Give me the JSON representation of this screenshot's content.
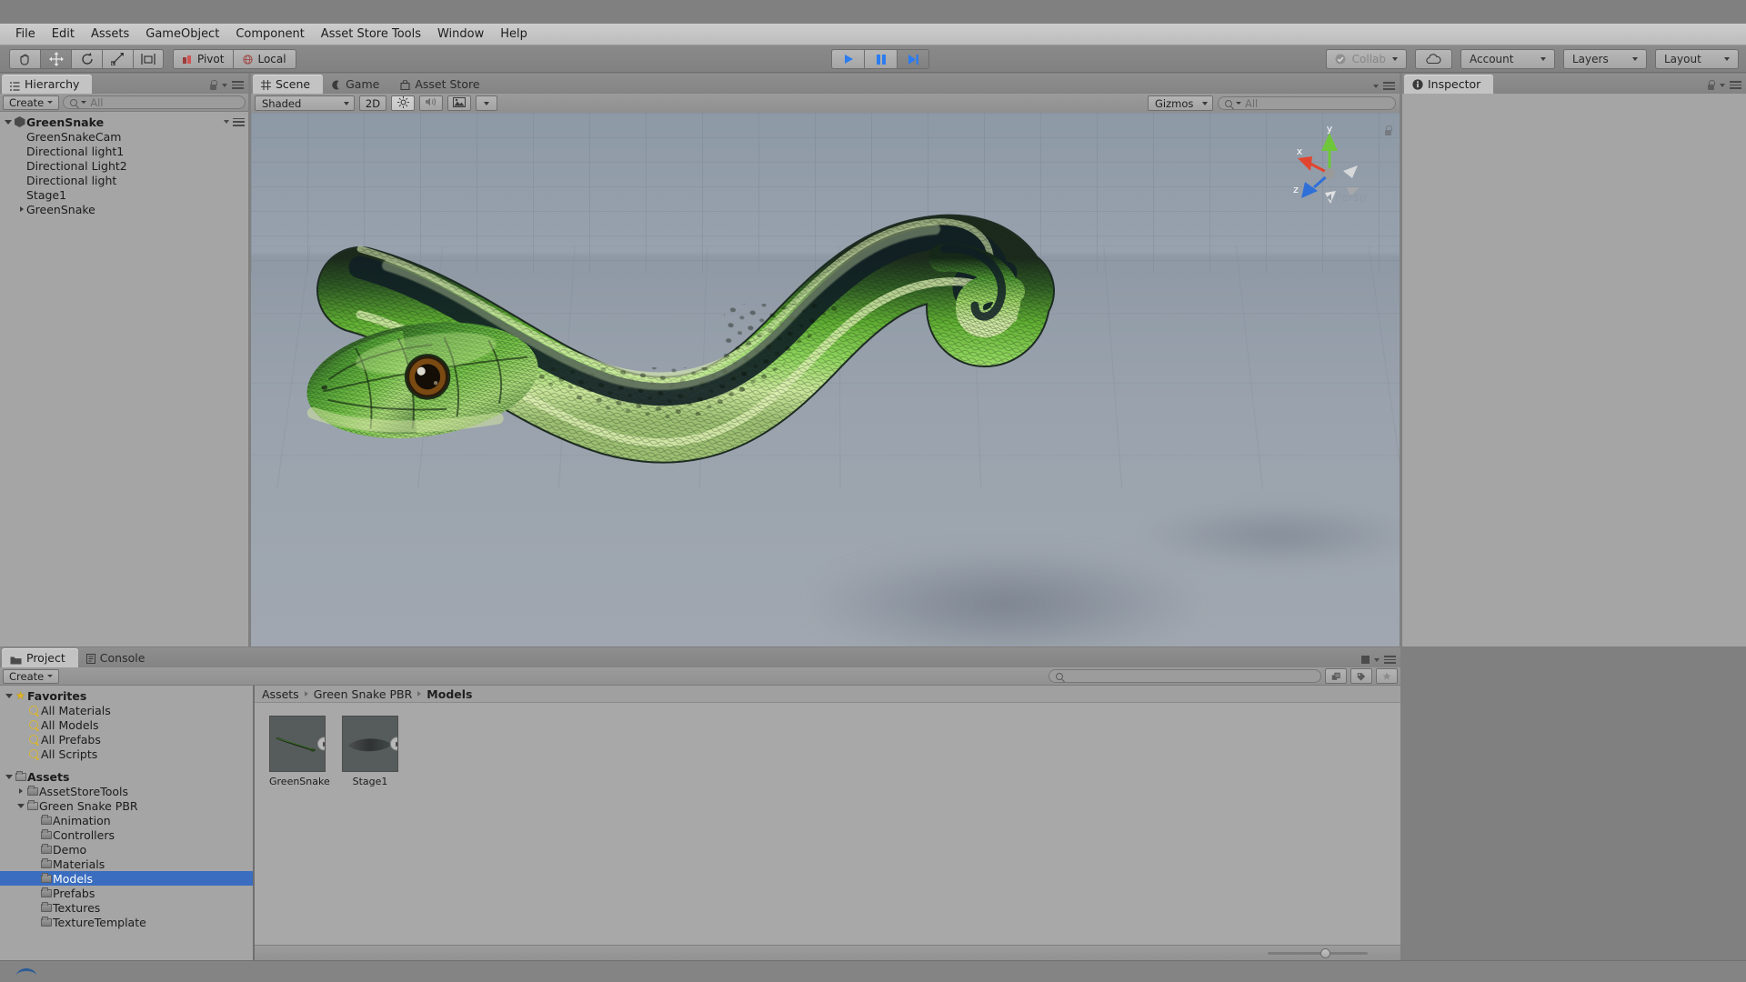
{
  "app": {
    "title": "Unity Editor"
  },
  "menubar": {
    "items": [
      {
        "label": "File"
      },
      {
        "label": "Edit"
      },
      {
        "label": "Assets"
      },
      {
        "label": "GameObject"
      },
      {
        "label": "Component"
      },
      {
        "label": "Asset Store Tools"
      },
      {
        "label": "Window"
      },
      {
        "label": "Help"
      }
    ]
  },
  "toolbar": {
    "tools": [
      {
        "name": "hand-tool",
        "icon": "hand-icon",
        "active": false
      },
      {
        "name": "move-tool",
        "icon": "move-icon",
        "active": true
      },
      {
        "name": "rotate-tool",
        "icon": "rotate-icon",
        "active": false
      },
      {
        "name": "scale-tool",
        "icon": "scale-icon",
        "active": false
      },
      {
        "name": "rect-tool",
        "icon": "rect-transform-icon",
        "active": false
      }
    ],
    "pivot_label": "Pivot",
    "local_label": "Local",
    "play_label": "play-icon",
    "pause_label": "pause-icon",
    "step_label": "step-icon",
    "collab_label": "Collab",
    "cloud_label": "cloud-icon",
    "account_label": "Account",
    "layers_label": "Layers",
    "layout_label": "Layout"
  },
  "hierarchy": {
    "tab_label": "Hierarchy",
    "create_label": "Create",
    "search_placeholder": "All",
    "root": {
      "label": "GreenSnake",
      "expanded": true
    },
    "items": [
      {
        "label": "GreenSnakeCam",
        "indent": 1,
        "expandable": false
      },
      {
        "label": "Directional light1",
        "indent": 1,
        "expandable": false
      },
      {
        "label": "Directional Light2",
        "indent": 1,
        "expandable": false
      },
      {
        "label": "Directional light",
        "indent": 1,
        "expandable": false
      },
      {
        "label": "Stage1",
        "indent": 1,
        "expandable": false
      },
      {
        "label": "GreenSnake",
        "indent": 1,
        "expandable": true
      }
    ]
  },
  "scene": {
    "tabs": [
      {
        "label": "Scene",
        "icon": "grid-icon",
        "active": true
      },
      {
        "label": "Game",
        "icon": "gamepad-icon",
        "active": false
      },
      {
        "label": "Asset Store",
        "icon": "store-icon",
        "active": false
      }
    ],
    "draw_mode": "Shaded",
    "two_d_label": "2D",
    "light_icon": "lighting-icon",
    "audio_icon": "audio-icon",
    "fx_icon": "effects-icon",
    "gizmos_label": "Gizmos",
    "search_placeholder": "All",
    "axis_labels": {
      "x": "x",
      "y": "y",
      "z": "z"
    },
    "projection_label": "Persp",
    "colors": {
      "x_axis": "#d83b2c",
      "y_axis": "#5fc22a",
      "z_axis": "#2f6fd8",
      "background_top": "#8e99a6",
      "background_bottom": "#a0a7b0"
    },
    "object": {
      "name": "GreenSnake",
      "type": "3d-model"
    }
  },
  "inspector": {
    "tab_label": "Inspector"
  },
  "project": {
    "tabs": [
      {
        "label": "Project",
        "icon": "folder-icon",
        "active": true
      },
      {
        "label": "Console",
        "icon": "console-icon",
        "active": false
      }
    ],
    "create_label": "Create",
    "search_placeholder": "",
    "favorites": {
      "label": "Favorites",
      "expanded": true,
      "items": [
        {
          "label": "All Materials"
        },
        {
          "label": "All Models"
        },
        {
          "label": "All Prefabs"
        },
        {
          "label": "All Scripts"
        }
      ]
    },
    "assets": {
      "label": "Assets",
      "expanded": true,
      "items": [
        {
          "label": "AssetStoreTools",
          "indent": 1,
          "expandable": true,
          "expanded": false,
          "selected": false
        },
        {
          "label": "Green Snake PBR",
          "indent": 1,
          "expandable": true,
          "expanded": true,
          "selected": false
        },
        {
          "label": "Animation",
          "indent": 2,
          "expandable": false,
          "selected": false
        },
        {
          "label": "Controllers",
          "indent": 2,
          "expandable": false,
          "selected": false
        },
        {
          "label": "Demo",
          "indent": 2,
          "expandable": false,
          "selected": false
        },
        {
          "label": "Materials",
          "indent": 2,
          "expandable": false,
          "selected": false
        },
        {
          "label": "Models",
          "indent": 2,
          "expandable": false,
          "selected": true
        },
        {
          "label": "Prefabs",
          "indent": 2,
          "expandable": false,
          "selected": false
        },
        {
          "label": "Textures",
          "indent": 2,
          "expandable": false,
          "selected": false
        },
        {
          "label": "TextureTemplate",
          "indent": 2,
          "expandable": false,
          "selected": false
        }
      ]
    },
    "breadcrumb": [
      {
        "label": "Assets",
        "current": false
      },
      {
        "label": "Green Snake PBR",
        "current": false
      },
      {
        "label": "Models",
        "current": true
      }
    ],
    "assets_grid": [
      {
        "label": "GreenSnake",
        "type": "model"
      },
      {
        "label": "Stage1",
        "type": "model"
      }
    ],
    "zoom_value": 55
  }
}
